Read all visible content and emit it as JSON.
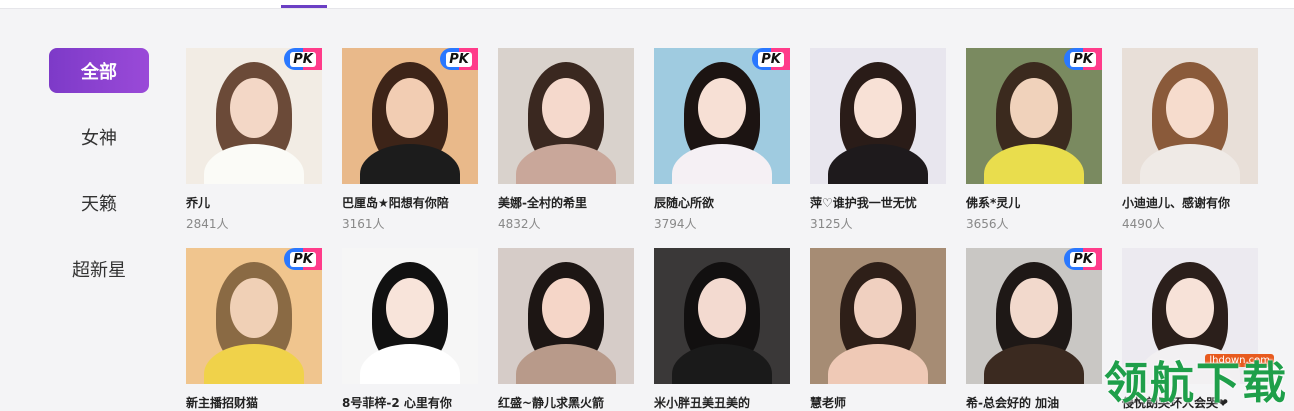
{
  "sidebar": {
    "categories": [
      "全部",
      "女神",
      "天籁",
      "超新星"
    ]
  },
  "pk_label": "PK",
  "rooms": [
    {
      "name": "乔儿",
      "count": "2841人",
      "pk": true,
      "bg": "#f2ece4",
      "skin": "#f3d7c6",
      "hair": "#6b4a38",
      "cloth": "#fbfbf7"
    },
    {
      "name": "巴厘岛★阳想有你陪",
      "count": "3161人",
      "pk": true,
      "bg": "#e9b98a",
      "skin": "#f2cdb3",
      "hair": "#3d2418",
      "cloth": "#1c1c1c"
    },
    {
      "name": "美娜-全村的希里",
      "count": "4832人",
      "pk": false,
      "bg": "#d9d2cc",
      "skin": "#f5d9cc",
      "hair": "#3a2820",
      "cloth": "#c9a79a"
    },
    {
      "name": "辰随心所欲",
      "count": "3794人",
      "pk": true,
      "bg": "#9fcbe0",
      "skin": "#f7e0d5",
      "hair": "#1c1412",
      "cloth": "#f5f0f4"
    },
    {
      "name": "萍♡谁护我一世无忧",
      "count": "3125人",
      "pk": false,
      "bg": "#e8e6ee",
      "skin": "#f8e1d6",
      "hair": "#2a1c18",
      "cloth": "#1e1a1c"
    },
    {
      "name": "佛系*灵儿",
      "count": "3656人",
      "pk": true,
      "bg": "#7a8a60",
      "skin": "#f0d2bb",
      "hair": "#3b2a1e",
      "cloth": "#e9dd4d"
    },
    {
      "name": "小迪迪儿、感谢有你",
      "count": "4490人",
      "pk": false,
      "bg": "#e8dfd8",
      "skin": "#f6dccd",
      "hair": "#8a5a3a",
      "cloth": "#efeae6"
    },
    {
      "name": "新主播招财猫",
      "count": "",
      "pk": true,
      "bg": "#f0c58e",
      "skin": "#f0d0b6",
      "hair": "#8a6a44",
      "cloth": "#f0d24a"
    },
    {
      "name": "8号菲梓-2 心里有你",
      "count": "",
      "pk": false,
      "bg": "#f6f6f6",
      "skin": "#f8e4da",
      "hair": "#111111",
      "cloth": "#ffffff"
    },
    {
      "name": "红盛~静儿求黑火箭",
      "count": "",
      "pk": false,
      "bg": "#d6ccc8",
      "skin": "#f5d6c8",
      "hair": "#1d1614",
      "cloth": "#b89a8a"
    },
    {
      "name": "米小胖丑美丑美的",
      "count": "",
      "pk": false,
      "bg": "#3a3838",
      "skin": "#f3dad0",
      "hair": "#121010",
      "cloth": "#1a1a1a"
    },
    {
      "name": "慧老师",
      "count": "",
      "pk": false,
      "bg": "#a68c74",
      "skin": "#f0d0c0",
      "hair": "#2e1f18",
      "cloth": "#efc9b6"
    },
    {
      "name": "希-总会好的 加油",
      "count": "",
      "pk": true,
      "bg": "#c9c7c4",
      "skin": "#f2d9cc",
      "hair": "#1e1816",
      "cloth": "#3b2a20"
    },
    {
      "name": "侵悦朗哭坏人会哭❤",
      "count": "",
      "pk": false,
      "bg": "#eceaf0",
      "skin": "#f7e2d8",
      "hair": "#2b1f1b",
      "cloth": "#f2f0f2"
    }
  ],
  "watermark": {
    "text": "领航下载",
    "url": "lhdown.com"
  },
  "colors": {
    "accent": "#7d3ac8",
    "pk_blue": "#2a78ff",
    "pk_pink": "#ff3b8a"
  }
}
